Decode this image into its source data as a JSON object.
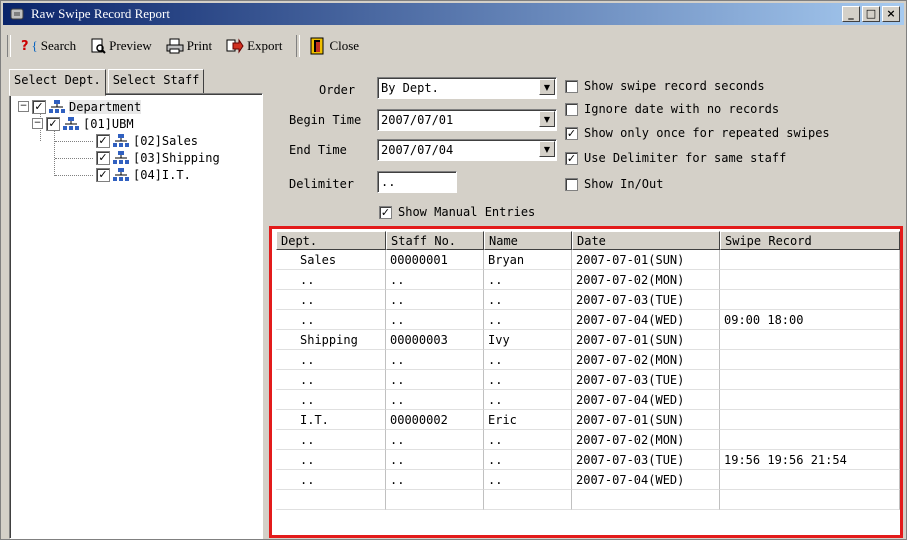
{
  "window": {
    "title": "Raw Swipe Record Report",
    "controls": [
      "_",
      "□",
      "×"
    ]
  },
  "toolbar": {
    "search": "Search",
    "preview": "Preview",
    "print": "Print",
    "export": "Export",
    "close": "Close"
  },
  "left": {
    "tabs": [
      "Select Dept.",
      "Select Staff"
    ],
    "tree": [
      {
        "label": "Department",
        "checked": true,
        "expand": "−"
      },
      {
        "label": "[01]UBM",
        "checked": true,
        "expand": "−"
      },
      {
        "label": "[02]Sales",
        "checked": true
      },
      {
        "label": "[03]Shipping",
        "checked": true
      },
      {
        "label": "[04]I.T.",
        "checked": true
      }
    ]
  },
  "filters": {
    "order_label": "Order",
    "order_value": "By Dept.",
    "begin_label": "Begin Time",
    "begin_value": "2007/07/01",
    "end_label": "End Time",
    "end_value": "2007/07/04",
    "delimiter_label": "Delimiter",
    "delimiter_value": "..",
    "show_manual": "Show Manual Entries",
    "options": [
      {
        "label": "Show swipe record seconds",
        "checked": false
      },
      {
        "label": "Ignore date with no records",
        "checked": false
      },
      {
        "label": "Show only once for repeated swipes",
        "checked": true
      },
      {
        "label": "Use Delimiter for same staff",
        "checked": true
      },
      {
        "label": "Show In/Out",
        "checked": false
      }
    ]
  },
  "grid": {
    "headers": [
      "Dept.",
      "Staff No.",
      "Name",
      "Date",
      "Swipe Record"
    ],
    "rows": [
      [
        "Sales",
        "00000001",
        "Bryan",
        "2007-07-01(SUN)",
        ""
      ],
      [
        "..",
        "..",
        "..",
        "2007-07-02(MON)",
        ""
      ],
      [
        "..",
        "..",
        "..",
        "2007-07-03(TUE)",
        ""
      ],
      [
        "..",
        "..",
        "..",
        "2007-07-04(WED)",
        "09:00 18:00"
      ],
      [
        "Shipping",
        "00000003",
        "Ivy",
        "2007-07-01(SUN)",
        ""
      ],
      [
        "..",
        "..",
        "..",
        "2007-07-02(MON)",
        ""
      ],
      [
        "..",
        "..",
        "..",
        "2007-07-03(TUE)",
        ""
      ],
      [
        "..",
        "..",
        "..",
        "2007-07-04(WED)",
        ""
      ],
      [
        "I.T.",
        "00000002",
        "Eric",
        "2007-07-01(SUN)",
        ""
      ],
      [
        "..",
        "..",
        "..",
        "2007-07-02(MON)",
        ""
      ],
      [
        "..",
        "..",
        "..",
        "2007-07-03(TUE)",
        "19:56 19:56 21:54"
      ],
      [
        "..",
        "..",
        "..",
        "2007-07-04(WED)",
        ""
      ]
    ]
  }
}
